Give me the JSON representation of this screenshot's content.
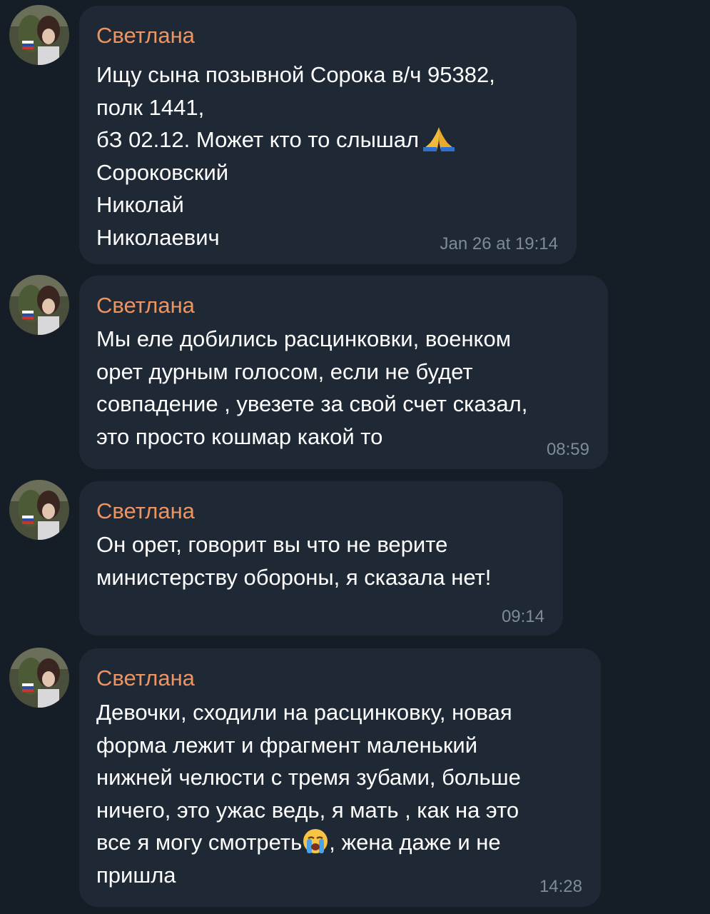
{
  "chat": {
    "messages": [
      {
        "sender": "Светлана",
        "lines": [
          "Ищу сына позывной Сорока в/ч 95382,",
          "полк 1441,",
          "бЗ 02.12. Может кто то слышал",
          "Сороковский",
          "Николай",
          "Николаевич"
        ],
        "emoji": "folded-hands",
        "time": "Jan 26 at 19:14"
      },
      {
        "sender": "Светлана",
        "lines": [
          "Мы еле добились расцинковки, военком",
          "орет дурным голосом, если не будет",
          "совпадение , увезете за свой счет сказал,",
          "это просто кошмар какой то"
        ],
        "time": "08:59"
      },
      {
        "sender": "Светлана",
        "lines": [
          "Он орет, говорит вы что не верите",
          "министерству обороны, я сказала нет!"
        ],
        "time": "09:14"
      },
      {
        "sender": "Светлана",
        "lines": [
          "Девочки, сходили на расцинковку, новая",
          "форма лежит и фрагмент маленький",
          "нижней челюсти с тремя зубами, больше",
          "ничего, это ужас ведь, я мать , как на это",
          "все я могу смотреть",
          "пришла"
        ],
        "line5_after_emoji": ", жена даже и не",
        "emoji": "loudly-crying-face",
        "time": "14:28"
      }
    ]
  },
  "colors": {
    "background": "#151d27",
    "bubble": "#1f2935",
    "sender_name": "#f0935f",
    "message_text": "#ffffff",
    "timestamp": "#7f8b99"
  }
}
